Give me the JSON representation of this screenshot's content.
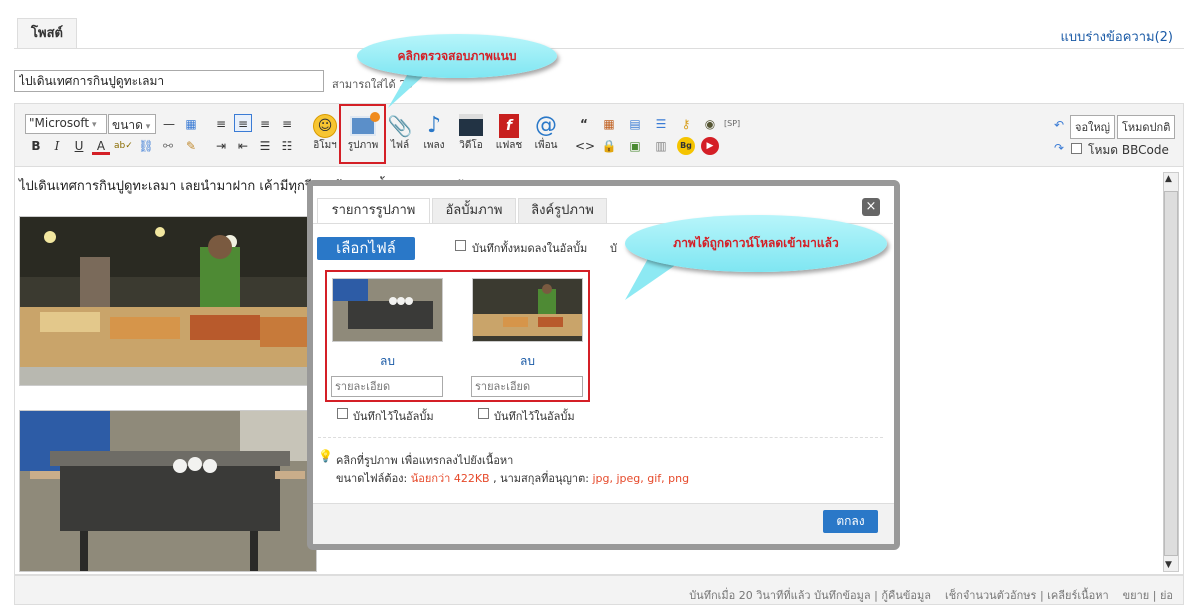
{
  "header": {
    "post_tab": "โพสต์",
    "drafts_link": "แบบร่างข้อความ(2)"
  },
  "title_field": {
    "value": "ไปเดินเทศการกินปูดูทะเลมา",
    "hint": "สามารถใส่ได้ 25"
  },
  "toolbar": {
    "font_combo": "\"Microsoft",
    "size_combo": "ขนาด",
    "sp_label": "[SP]",
    "labels": {
      "emoji": "อิโมฯ",
      "image": "รูปภาพ",
      "file": "ไฟล์",
      "song": "เพลง",
      "video": "วิดีโอ",
      "flash": "แฟลช",
      "friend": "เพื่อน"
    },
    "fullscreen_btn": "จอใหญ่",
    "normal_mode_btn": "โหมดปกติ",
    "bbcode_label": "โหมด BBCode"
  },
  "content": {
    "first_line": "ไปเดินเทศการกินปูดูทะเลมา เลยนำมาฝาก เค้ามีทุกปี ดูแล้วอย่า น้ำลายหกน่ะครับ"
  },
  "dialog": {
    "tabs": [
      "รายการรูปภาพ",
      "อัลบั้มภาพ",
      "ลิงค์รูปภาพ"
    ],
    "choose_file": "เลือกไฟล์",
    "save_all_label": "บันทึกทั้งหมดลงในอัลบั้ม",
    "save_all_trail": "บั",
    "images": [
      {
        "delete_label": "ลบ",
        "caption_placeholder": "รายละเอียด",
        "save_label": "บันทึกไว้ในอัลบั้ม"
      },
      {
        "delete_label": "ลบ",
        "caption_placeholder": "รายละเอียด",
        "save_label": "บันทึกไว้ในอัลบั้ม"
      }
    ],
    "tip": "คลิกที่รูปภาพ เพื่อแทรกลงไปยังเนื้อหา",
    "size_prefix": "ขนาดไฟล์ต้อง:",
    "size_value": "น้อยกว่า 422KB",
    "ext_prefix": ", นามสกุลที่อนุญาต:",
    "ext_value": "jpg, jpeg, gif, png",
    "ok_label": "ตกลง",
    "close_symbol": "×"
  },
  "callouts": {
    "check_attach": "คลิกตรวจสอบภาพแนบ",
    "downloaded": "ภาพได้ถูกดาวน์โหลดเข้ามาแล้ว"
  },
  "status_bar": {
    "text": "บันทึกเมื่อ 20 วินาทีที่แล้ว บันทึกข้อมูล | กู้คืนข้อมูล    เช็กจำนวนตัวอักษร | เคลียร์เนื้อหา    ขยาย | ย่อ"
  },
  "colors": {
    "accent_blue": "#2a78c8",
    "highlight_red": "#d41f26",
    "callout_cyan": "#7fe6f2",
    "size_text": "#e6492a"
  },
  "icons": [
    "emoji-icon",
    "image-icon",
    "paperclip-icon",
    "music-note-icon",
    "video-icon",
    "flash-icon",
    "at-icon",
    "bold-icon",
    "italic-icon",
    "underline-icon",
    "quote-icon",
    "code-icon",
    "undo-icon",
    "redo-icon"
  ]
}
